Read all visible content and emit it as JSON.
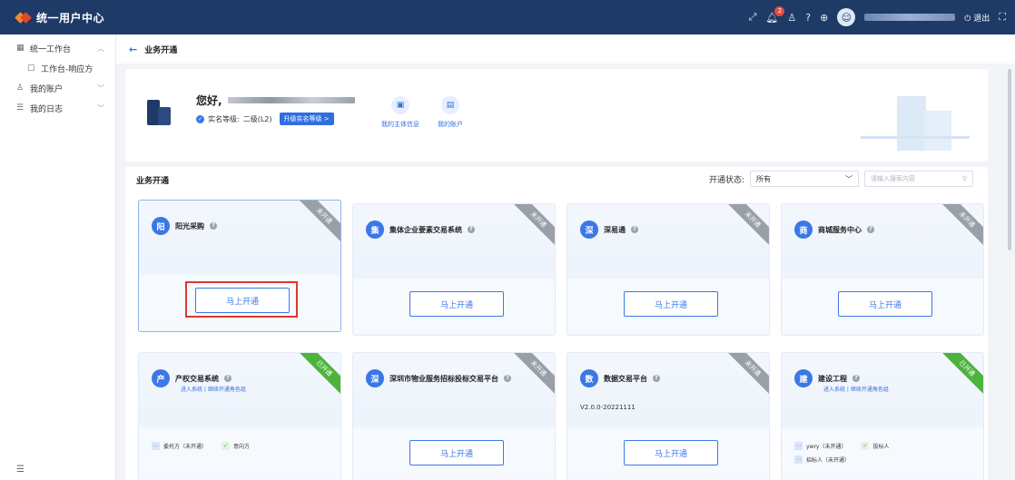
{
  "app": {
    "title": "统一用户中心"
  },
  "topbar": {
    "badge_count": "2",
    "logout_label": "退出"
  },
  "sidebar": {
    "items": [
      {
        "label": "统一工作台",
        "icon": "grid-icon"
      },
      {
        "label": "工作台-响应方",
        "icon": "doc-icon"
      },
      {
        "label": "我的账户",
        "icon": "user-icon"
      },
      {
        "label": "我的日志",
        "icon": "list-icon"
      }
    ]
  },
  "breadcrumb": {
    "title": "业务开通"
  },
  "welcome": {
    "greeting": "您好,",
    "cert_label": "实名等级:",
    "cert_level": "二级(L2)",
    "upgrade_label": "升级实名等级 >",
    "quick": [
      {
        "label": "我的主体信息"
      },
      {
        "label": "我的账户"
      }
    ]
  },
  "business": {
    "title": "业务开通",
    "filter_label": "开通状态:",
    "filter_value": "所有",
    "search_placeholder": "请输入搜索内容",
    "open_button": "马上开通",
    "cards": [
      {
        "char": "阳",
        "title": "阳光采购",
        "status": "未开通"
      },
      {
        "char": "集",
        "title": "集体企业要素交易系统",
        "status": "未开通"
      },
      {
        "char": "深",
        "title": "深易通",
        "status": "未开通"
      },
      {
        "char": "商",
        "title": "商城服务中心",
        "status": "未开通"
      },
      {
        "char": "产",
        "title": "产权交易系统",
        "status": "已开通",
        "links": "进入系统 | 继续开通角色组",
        "roles": [
          "委托方（未开通）",
          "意向方"
        ]
      },
      {
        "char": "深",
        "title": "深圳市物业服务招标投标交易平台",
        "status": "未开通"
      },
      {
        "char": "数",
        "title": "数据交易平台",
        "status": "未开通",
        "version": "V2.0.0-20221111"
      },
      {
        "char": "建",
        "title": "建设工程",
        "status": "已开通",
        "links": "进入系统 | 继续开通角色组",
        "roles": [
          "ywry（未开通）",
          "投标人",
          "招标人（未开通）"
        ]
      }
    ]
  },
  "colors": {
    "topbar": "#1e3a66",
    "accent": "#3b78e7",
    "highlight": "#e0362c",
    "ribbon_open": "#4db33d",
    "ribbon_closed": "#9aa0a8"
  }
}
